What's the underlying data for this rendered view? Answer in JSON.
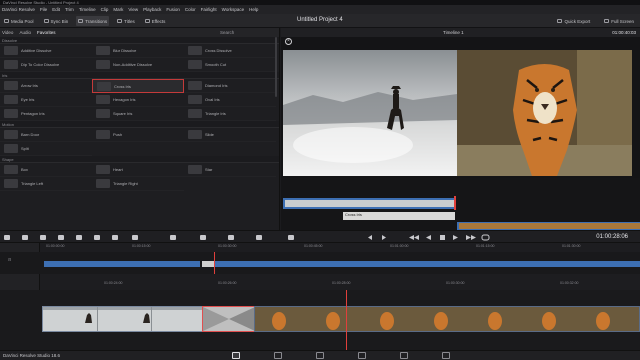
{
  "window": {
    "title": "DaVinci Resolve Studio - Untitled Project 4"
  },
  "menu": [
    "DaVinci Resolve",
    "File",
    "Edit",
    "Trim",
    "Timeline",
    "Clip",
    "Mark",
    "View",
    "Playback",
    "Fusion",
    "Color",
    "Fairlight",
    "Workspace",
    "Help"
  ],
  "toolbar": {
    "media_pool": "Media Pool",
    "sync_bin": "Sync Bin",
    "transitions": "Transitions",
    "titles": "Titles",
    "effects": "Effects",
    "project_title": "Untitled Project 4",
    "quick_export": "Quick Export",
    "full_screen": "Full Screen"
  },
  "library": {
    "tabs": {
      "video": "Video",
      "audio": "Audio",
      "favorites": "Favorites"
    },
    "search": "Search",
    "sections": [
      {
        "name": "Dissolve",
        "items": [
          "Additive Dissolve",
          "Blur Dissolve",
          "Cross Dissolve",
          "Dip To Color Dissolve",
          "Non-Additive Dissolve",
          "Smooth Cut"
        ]
      },
      {
        "name": "Iris",
        "items": [
          "Arrow Iris",
          "Cross Iris",
          "Diamond Iris",
          "Eye Iris",
          "Hexagon Iris",
          "Oval Iris",
          "Pentagon Iris",
          "Square Iris",
          "Triangle Iris"
        ]
      },
      {
        "name": "Motion",
        "items": [
          "Barn Door",
          "Push",
          "Slide",
          "Split"
        ]
      },
      {
        "name": "Shape",
        "items": [
          "Box",
          "Heart",
          "Star",
          "Triangle Left",
          "Triangle Right"
        ]
      }
    ],
    "selected_item": "Cross Iris"
  },
  "viewer": {
    "timeline_name": "Timeline 1",
    "timecode": "01:00:40:03",
    "transition_label": "Cross Iris"
  },
  "transport": {
    "timecode": "01:00:28:06"
  },
  "ruler_upper": [
    "01:00:00:00",
    "01:00:15:00",
    "01:00:30:00",
    "01:00:45:00",
    "01:01:00:00",
    "01:01:15:00",
    "01:01:30:00"
  ],
  "ruler_lower": [
    "01:00:24:00",
    "01:00:26:00",
    "01:00:28:00",
    "01:00:30:00",
    "01:00:32:00",
    "01:00:34:00",
    "01:00:36:00",
    "01:00:38:00"
  ],
  "tracks": {
    "v1": "V1",
    "a1": "A1"
  },
  "bottom": {
    "app_name": "DaVinci Resolve Studio 18.6"
  },
  "colors": {
    "accent": "#e0403c",
    "clip_blue": "#3d6fb3",
    "selection": "#c43a3a"
  }
}
